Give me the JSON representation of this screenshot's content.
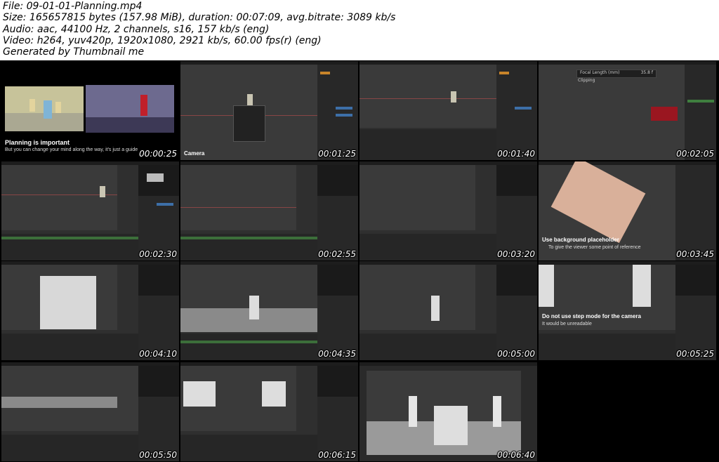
{
  "header": {
    "file": "File: 09-01-01-Planning.mp4",
    "size": "Size: 165657815 bytes (157.98 MiB), duration: 00:07:09, avg.bitrate: 3089 kb/s",
    "audio": "Audio: aac, 44100 Hz, 2 channels, s16, 157 kb/s (eng)",
    "video": "Video: h264, yuv420p, 1920x1080, 2921 kb/s, 60.00 fps(r) (eng)",
    "generated": "Generated by Thumbnail me"
  },
  "thumbnails": [
    {
      "time": "00:00:25",
      "title": "Planning is important",
      "subtitle": "But you can change your mind along the way, it's just a guide"
    },
    {
      "time": "00:01:25",
      "label": "Camera"
    },
    {
      "time": "00:01:40"
    },
    {
      "time": "00:02:05",
      "popup_title": "Focal Length (mm)",
      "popup_value": "35.8 f",
      "popup_sub": "Clipping"
    },
    {
      "time": "00:02:30"
    },
    {
      "time": "00:02:55"
    },
    {
      "time": "00:03:20"
    },
    {
      "time": "00:03:45",
      "title": "Use background placeholder",
      "subtitle": "To give the viewer some point of reference"
    },
    {
      "time": "00:04:10"
    },
    {
      "time": "00:04:35"
    },
    {
      "time": "00:05:00"
    },
    {
      "time": "00:05:25",
      "title": "Do not use step mode for the camera",
      "subtitle": "It would be unreadable"
    },
    {
      "time": "00:05:50"
    },
    {
      "time": "00:06:15"
    },
    {
      "time": "00:06:40"
    }
  ]
}
